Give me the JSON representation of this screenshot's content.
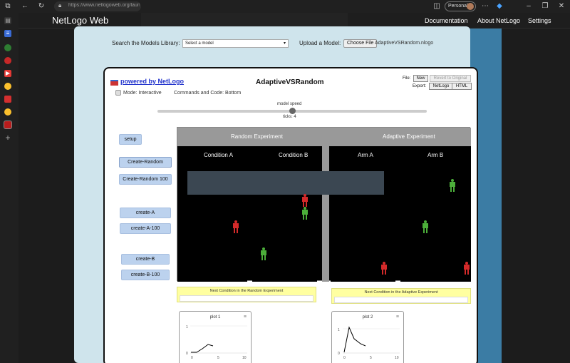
{
  "browser": {
    "url": "https://www.netlogoweb.org/launch",
    "profile_label": "Personal"
  },
  "nl_header": {
    "brand": "NetLogo Web",
    "nav": [
      "Documentation",
      "About NetLogo",
      "Settings"
    ]
  },
  "library": {
    "search_label": "Search the Models Library:",
    "select_value": "Select a model",
    "upload_label": "Upload a Model:",
    "choose_file_label": "Choose File",
    "file_name": "AdaptiveVSRandom.nlogo"
  },
  "model": {
    "powered_by": "powered by NetLogo",
    "title": "AdaptiveVSRandom",
    "file_label": "File:",
    "new_label": "New",
    "revert_label": "Revert to Original",
    "export_label": "Export:",
    "export_netlogo": "NetLogo",
    "export_html": "HTML",
    "mode": "Mode: Interactive",
    "commands": "Commands and Code: Bottom",
    "speed_label": "model speed",
    "speed_level": 0.5,
    "ticks_label": "ticks: 4"
  },
  "buttons": {
    "setup": "setup",
    "create_random": "Create-Random",
    "create_random_100": "Create-Random 100",
    "create_a": "create-A",
    "create_a_100": "create-A-100",
    "create_b": "create-B",
    "create_b_100": "create-B-100"
  },
  "view": {
    "random_experiment": "Random Experiment",
    "adaptive_experiment": "Adaptive Experiment",
    "condition_a": "Condition A",
    "condition_b": "Condition B",
    "arm_a": "Arm A",
    "arm_b": "Arm B"
  },
  "monitors": {
    "random_next": "Next Condition in the Random Experiment",
    "adaptive_next": "Next Condition in the Adaptive Experiment"
  },
  "plots": {
    "plot1_title": "plot 1",
    "plot2_title": "plot 2",
    "y_tick": "1",
    "y_zero": "0",
    "x_start": "0",
    "x_mid": "5",
    "x_end": "10"
  },
  "colors": {
    "red_person": "#d42a2a",
    "green_person": "#4caf3a",
    "button_bg": "#bcd2ee",
    "monitor_bg": "#ffffa0"
  }
}
